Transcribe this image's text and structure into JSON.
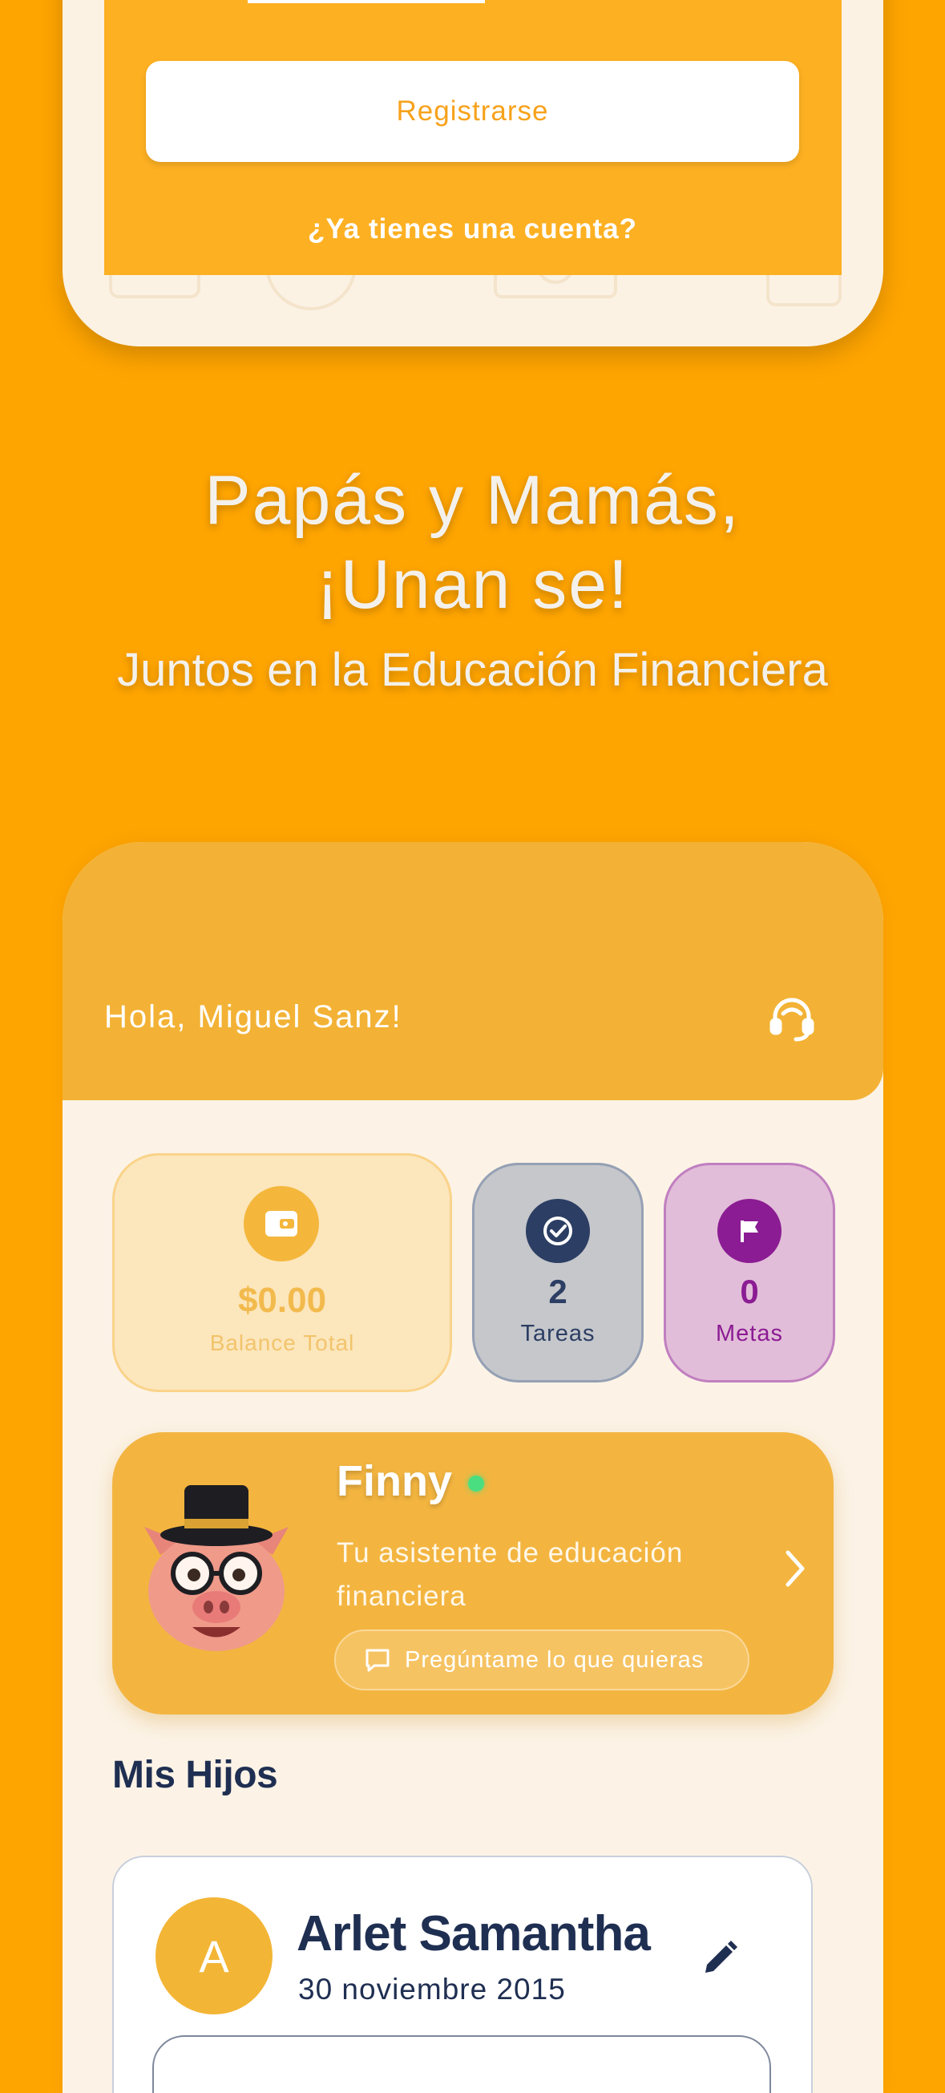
{
  "colors": {
    "background": "#FFA500",
    "accent": "#F3B235",
    "primary_text_dark": "#1F2F52",
    "tasks_dark": "#2C3E63",
    "goals_purple": "#8B1C93",
    "online_green": "#4ADE80"
  },
  "signup": {
    "register_label": "Registrarse",
    "have_account_label": "¿Ya tienes una cuenta?"
  },
  "promo": {
    "title_line1": "Papás y Mamás,",
    "title_line2": "¡Unan se!",
    "subtitle": "Juntos en la Educación Financiera"
  },
  "app": {
    "greeting": "Hola, Miguel Sanz!",
    "support_icon": "headset-icon",
    "stats": {
      "balance": {
        "value": "$0.00",
        "label": "Balance Total",
        "icon": "wallet-icon"
      },
      "tasks": {
        "value": "2",
        "label": "Tareas",
        "icon": "check-circle-icon"
      },
      "goals": {
        "value": "0",
        "label": "Metas",
        "icon": "flag-icon"
      }
    },
    "assistant": {
      "name": "Finny",
      "description": "Tu asistente de educación financiera",
      "ask_label": "Pregúntame lo que quieras",
      "avatar_icon": "pig-mascot-icon"
    },
    "children_section_title": "Mis Hijos",
    "children": [
      {
        "initial": "A",
        "name": "Arlet Samantha",
        "birthdate": "30 noviembre 2015"
      }
    ]
  }
}
